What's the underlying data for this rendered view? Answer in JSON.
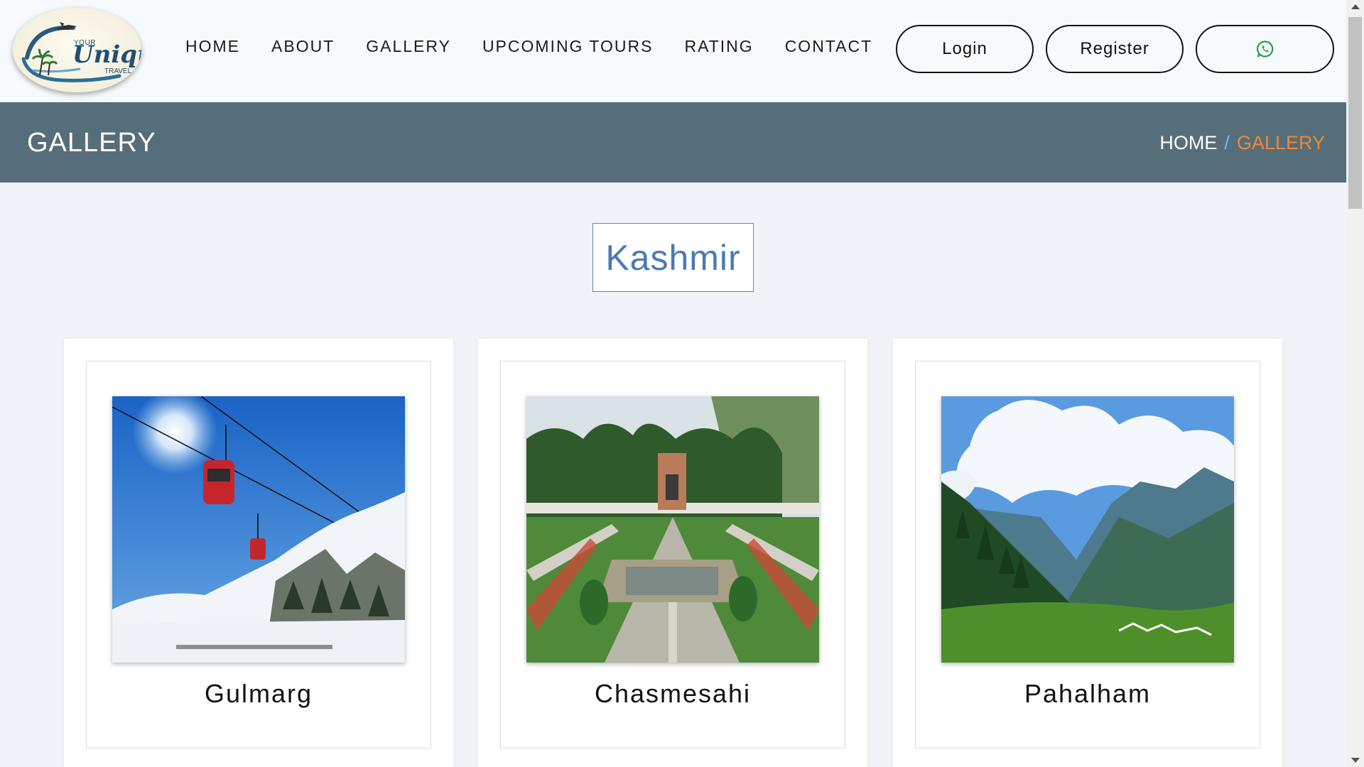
{
  "logo": {
    "line1": "YOUR",
    "line2": "Unique",
    "line3": "TRAVEL"
  },
  "nav": {
    "items": [
      {
        "label": "HOME"
      },
      {
        "label": "ABOUT"
      },
      {
        "label": "GALLERY"
      },
      {
        "label": "UPCOMING TOURS"
      },
      {
        "label": "RATING"
      },
      {
        "label": "CONTACT"
      }
    ],
    "login_label": "Login",
    "register_label": "Register",
    "whatsapp_icon": "whatsapp-icon"
  },
  "banner": {
    "title": "GALLERY",
    "breadcrumb": {
      "home": "HOME",
      "separator": "/",
      "current": "GALLERY"
    }
  },
  "section": {
    "title": "Kashmir"
  },
  "gallery": {
    "cards": [
      {
        "label": "Gulmarg"
      },
      {
        "label": "Chasmesahi"
      },
      {
        "label": "Pahalham"
      }
    ]
  },
  "colors": {
    "banner_bg": "#566e7a",
    "breadcrumb_current": "#f0873a",
    "section_title": "#4a7ab5",
    "whatsapp": "#25a244"
  }
}
